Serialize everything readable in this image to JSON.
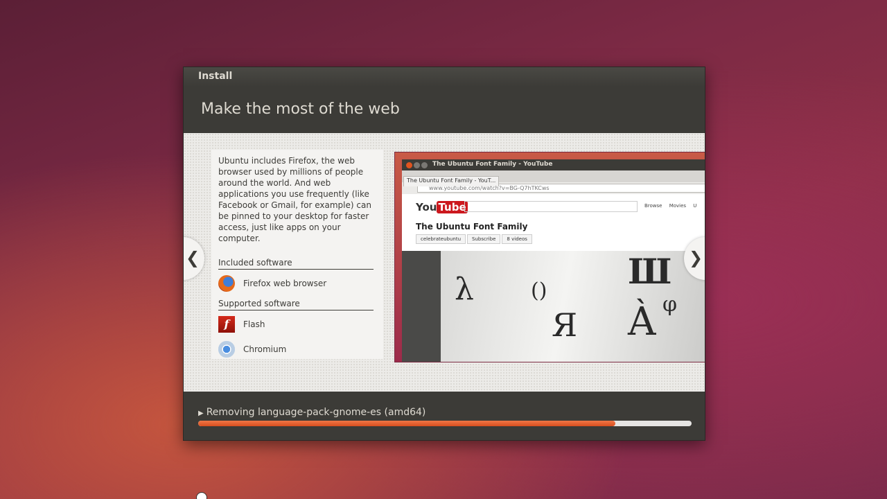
{
  "window": {
    "title": "Install"
  },
  "slide": {
    "headline": "Make the most of the web",
    "description": "Ubuntu includes Firefox, the web browser used by millions of people around the world. And web applications you use frequently (like Facebook or Gmail, for example) can be pinned to your desktop for faster access, just like apps on your computer.",
    "included": {
      "title": "Included software",
      "items": [
        {
          "label": "Firefox web browser",
          "icon": "firefox-icon"
        }
      ]
    },
    "supported": {
      "title": "Supported software",
      "items": [
        {
          "label": "Flash",
          "icon": "flash-icon"
        },
        {
          "label": "Chromium",
          "icon": "chromium-icon"
        }
      ]
    },
    "prev_arrow": "❮",
    "next_arrow": "❯"
  },
  "screenshot": {
    "window_title": "The Ubuntu Font Family - YouTube",
    "tab_label": "The Ubuntu Font Family - YouT...",
    "url": "www.youtube.com/watch?v=BG-Q7hTKCws",
    "logo_you": "You",
    "logo_tube": "Tube",
    "links": "Browse Movies U",
    "video_title": "The Ubuntu Font Family",
    "channel": "celebrateubuntu",
    "subscribe": "Subscribe",
    "videos": "8 videos"
  },
  "progress": {
    "status": "Removing language-pack-gnome-es (amd64)",
    "fraction": 0.845
  },
  "colors": {
    "accent": "#dd4814",
    "window_bg": "#3c3b37"
  }
}
